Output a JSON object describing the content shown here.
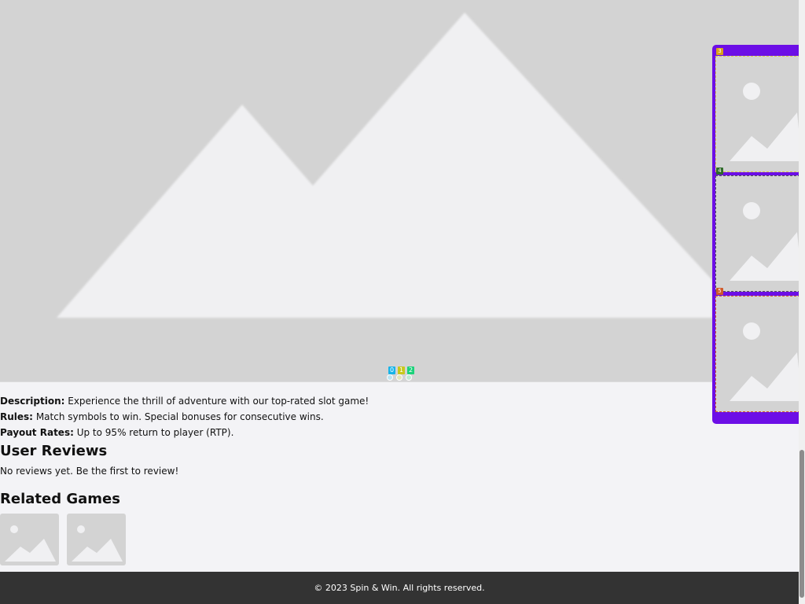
{
  "hero": {
    "image": "mountain-placeholder",
    "colors": {
      "bg": "#d3d3d3",
      "fg": "#f0f0f2"
    }
  },
  "carousel": {
    "indicators": [
      {
        "label": "0",
        "color": "#18b4e8"
      },
      {
        "label": "1",
        "color": "#c8c81a"
      },
      {
        "label": "2",
        "color": "#1ad27a"
      }
    ]
  },
  "rail": {
    "accent": "#6c0ee6",
    "items": [
      {
        "label": "3",
        "badge_color": "#d9a21a",
        "border": "#d8c24a"
      },
      {
        "label": "4",
        "badge_color": "#2f6b2a",
        "border": "#555555"
      },
      {
        "label": "5",
        "badge_color": "#d05a2a",
        "border": "#d05a2a"
      }
    ]
  },
  "details": {
    "description_label": "Description:",
    "description": "Experience the thrill of adventure with our top-rated slot game!",
    "rules_label": "Rules:",
    "rules": "Match symbols to win. Special bonuses for consecutive wins.",
    "payout_label": "Payout Rates:",
    "payout": "Up to 95% return to player (RTP)."
  },
  "reviews": {
    "heading": "User Reviews",
    "empty_text": "No reviews yet. Be the first to review!"
  },
  "related": {
    "heading": "Related Games",
    "items": [
      {
        "image": "placeholder"
      },
      {
        "image": "placeholder"
      }
    ]
  },
  "footer": {
    "text": "© 2023 Spin & Win. All rights reserved."
  }
}
